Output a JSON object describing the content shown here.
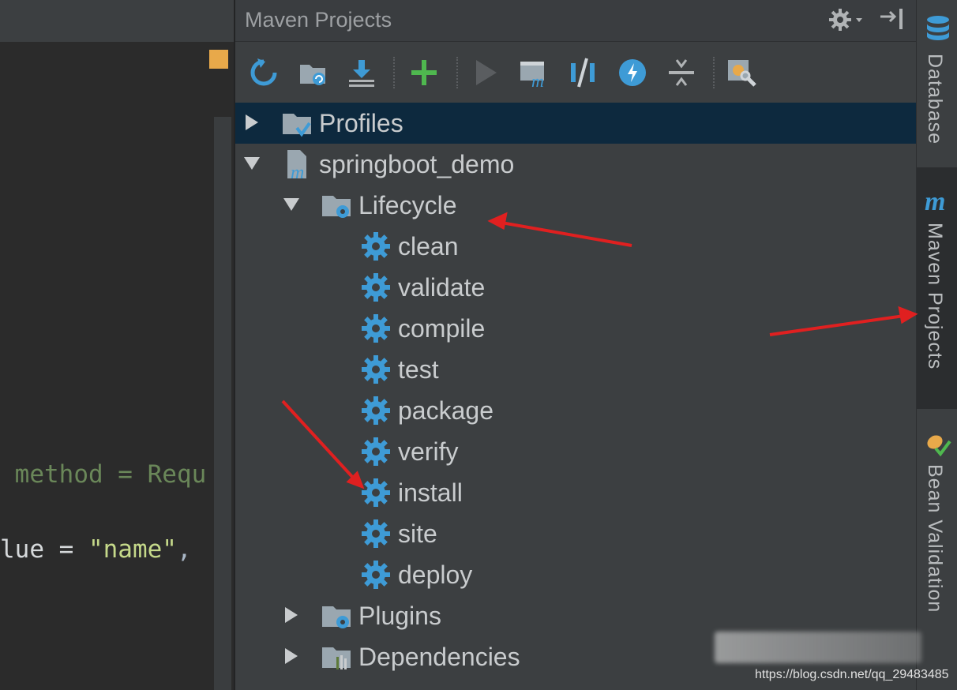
{
  "editor": {
    "code_line_1": {
      "prefix": " method = Requ"
    },
    "code_line_2": {
      "a": "lue = ",
      "b": "\"name\"",
      "c": ","
    }
  },
  "panel": {
    "title": "Maven Projects"
  },
  "toolbar": {
    "buttons": [
      "reimport-icon",
      "generate-sources-icon",
      "download-icon",
      "add-icon",
      "run-icon",
      "execute-maven-goal-icon",
      "toggle-offline-icon",
      "skip-tests-icon",
      "collapse-all-icon",
      "maven-settings-icon"
    ]
  },
  "tree": {
    "profiles": "Profiles",
    "project": "springboot_demo",
    "lifecycle": "Lifecycle",
    "goals": [
      "clean",
      "validate",
      "compile",
      "test",
      "package",
      "verify",
      "install",
      "site",
      "deploy"
    ],
    "plugins": "Plugins",
    "dependencies": "Dependencies"
  },
  "strip": {
    "database": "Database",
    "maven_projects": "Maven Projects",
    "bean_validation": "Bean Validation"
  },
  "colors": {
    "accent_blue": "#3e9bd6",
    "selection": "#0d293e",
    "arrow_red": "#e02020",
    "add_green": "#4fb84f"
  },
  "watermark": {
    "url": "https://blog.csdn.net/qq_29483485"
  }
}
